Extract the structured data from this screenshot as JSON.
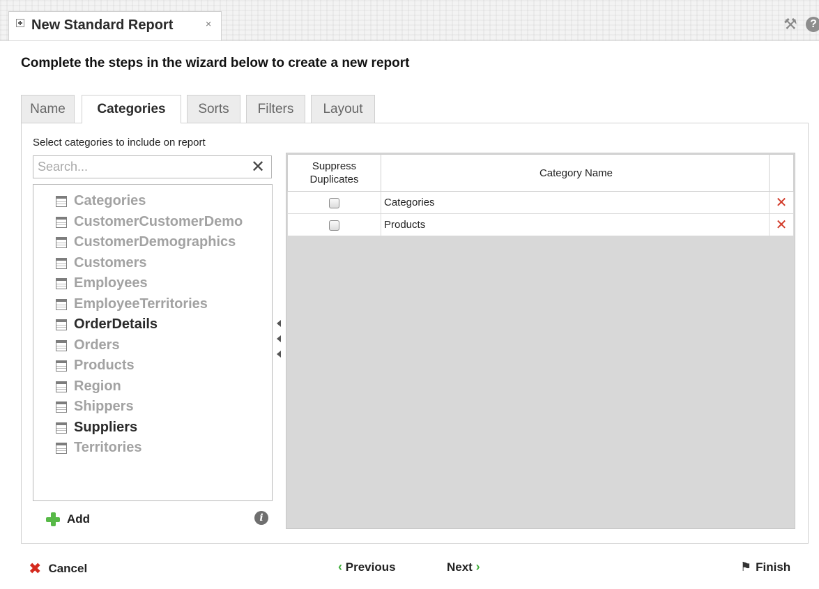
{
  "window": {
    "tab_title": "New Standard Report",
    "tab_close": "×",
    "tools_icon": "tools-icon",
    "help_icon": "help-icon",
    "help_glyph": "?"
  },
  "heading": "Complete the steps in the wizard below to create a new report",
  "wizard_tabs": [
    {
      "label": "Name",
      "active": false
    },
    {
      "label": "Categories",
      "active": true
    },
    {
      "label": "Sorts",
      "active": false
    },
    {
      "label": "Filters",
      "active": false
    },
    {
      "label": "Layout",
      "active": false
    }
  ],
  "left_panel": {
    "instruction": "Select categories to include on report",
    "search_placeholder": "Search...",
    "search_value": "",
    "clear_glyph": "✕",
    "categories": [
      {
        "label": "Categories",
        "selected": false
      },
      {
        "label": "CustomerCustomerDemo",
        "selected": false
      },
      {
        "label": "CustomerDemographics",
        "selected": false
      },
      {
        "label": "Customers",
        "selected": false
      },
      {
        "label": "Employees",
        "selected": false
      },
      {
        "label": "EmployeeTerritories",
        "selected": false
      },
      {
        "label": "OrderDetails",
        "selected": true
      },
      {
        "label": "Orders",
        "selected": false
      },
      {
        "label": "Products",
        "selected": false
      },
      {
        "label": "Region",
        "selected": false
      },
      {
        "label": "Shippers",
        "selected": false
      },
      {
        "label": "Suppliers",
        "selected": true
      },
      {
        "label": "Territories",
        "selected": false
      }
    ],
    "add_label": "Add",
    "info_glyph": "i"
  },
  "grid": {
    "headers": {
      "suppress_line1": "Suppress",
      "suppress_line2": "Duplicates",
      "category_name": "Category Name"
    },
    "rows": [
      {
        "suppress": false,
        "name": "Categories"
      },
      {
        "suppress": false,
        "name": "Products"
      }
    ],
    "delete_glyph": "✕"
  },
  "footer": {
    "cancel_label": "Cancel",
    "cancel_glyph": "✖",
    "previous_label": "Previous",
    "previous_glyph": "‹",
    "next_label": "Next",
    "next_glyph": "›",
    "finish_label": "Finish",
    "finish_glyph": "⚑"
  },
  "colors": {
    "accent_green": "#57b947",
    "delete_red": "#d23b2a",
    "muted_text": "#a2a2a2"
  }
}
